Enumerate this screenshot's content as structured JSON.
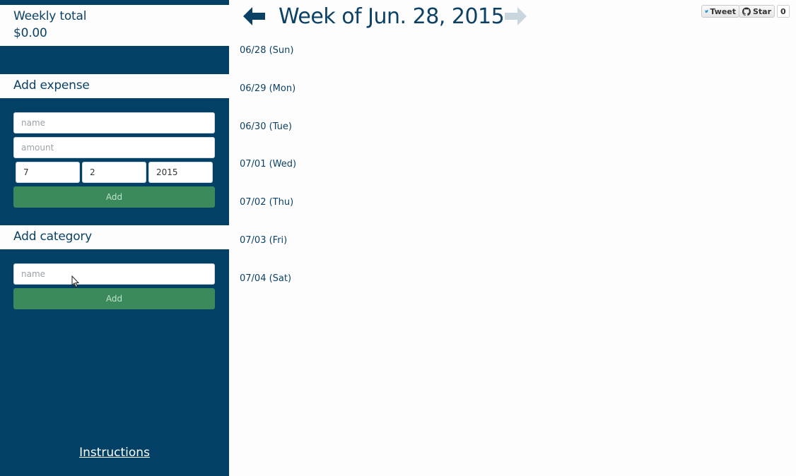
{
  "sidebar": {
    "weekly_total_label": "Weekly total",
    "weekly_total_value": "$0.00",
    "add_expense": {
      "heading": "Add expense",
      "name_placeholder": "name",
      "amount_placeholder": "amount",
      "month_value": "7",
      "day_value": "2",
      "year_value": "2015",
      "add_label": "Add"
    },
    "add_category": {
      "heading": "Add category",
      "name_placeholder": "name",
      "add_label": "Add"
    },
    "instructions_label": "Instructions"
  },
  "main": {
    "week_title": "Week of Jun. 28, 2015",
    "days": [
      "06/28 (Sun)",
      "06/29 (Mon)",
      "06/30 (Tue)",
      "07/01 (Wed)",
      "07/02 (Thu)",
      "07/03 (Fri)",
      "07/04 (Sat)"
    ]
  },
  "social": {
    "tweet_label": "Tweet",
    "star_label": "Star",
    "star_count": "0"
  },
  "colors": {
    "sidebar_bg": "#034066",
    "text_primary": "#0c4166",
    "add_button": "#3a8a5c",
    "next_arrow_disabled": "#c9d6dd"
  },
  "icons": {
    "prev": "arrow-left-icon",
    "next": "arrow-right-icon",
    "twitter": "twitter-bird-icon",
    "github": "github-octocat-icon",
    "cursor": "mouse-pointer-icon"
  }
}
